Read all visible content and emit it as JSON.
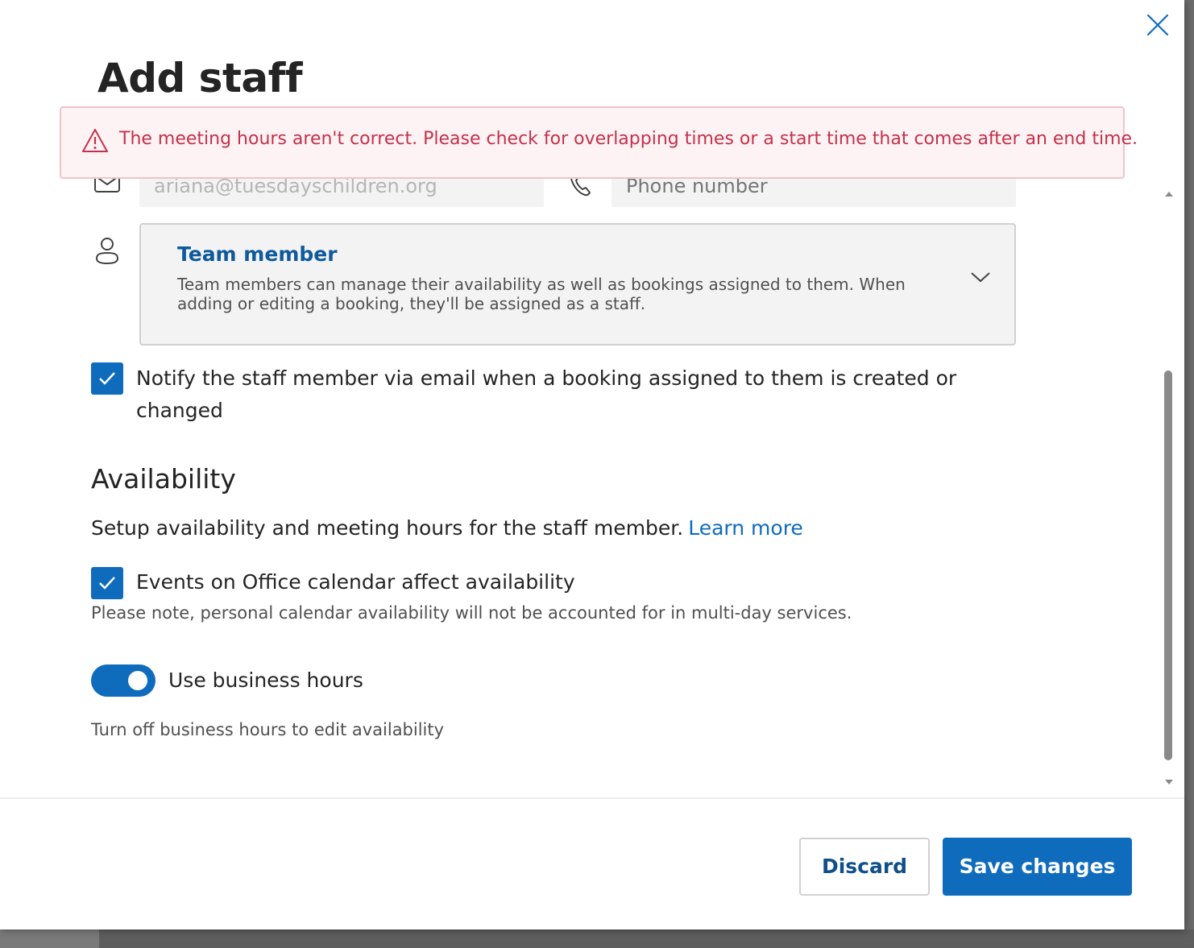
{
  "dialog": {
    "title": "Add staff"
  },
  "error": {
    "message": "The meeting hours aren't correct. Please check for overlapping times or a start time that comes after an end time."
  },
  "contact": {
    "email_value": "ariana@tuesdayschildren.org",
    "phone_placeholder": "Phone number"
  },
  "role": {
    "selected_title": "Team member",
    "selected_description": "Team members can manage their availability as well as bookings assigned to them. When adding or editing a booking, they'll be assigned as a staff."
  },
  "notify": {
    "checked": true,
    "label": "Notify the staff member via email when a booking assigned to them is created or changed"
  },
  "availability": {
    "heading": "Availability",
    "description": "Setup availability and meeting hours for the staff member.",
    "learn_more": "Learn more",
    "events_checked": true,
    "events_label": "Events on Office calendar affect availability",
    "events_note": "Please note, personal calendar availability will not be accounted for in multi-day services.",
    "business_hours_on": true,
    "business_hours_label": "Use business hours",
    "business_hours_note": "Turn off business hours to edit availability"
  },
  "footer": {
    "discard_label": "Discard",
    "save_label": "Save changes"
  },
  "colors": {
    "accent": "#0f6cbd",
    "error_text": "#c4314b",
    "error_bg": "#fdf3f4",
    "role_title": "#0f5a9c"
  },
  "icons": [
    "close-icon",
    "warning-icon",
    "mail-icon",
    "phone-icon",
    "person-icon",
    "chevron-down-icon",
    "checkmark-icon"
  ]
}
